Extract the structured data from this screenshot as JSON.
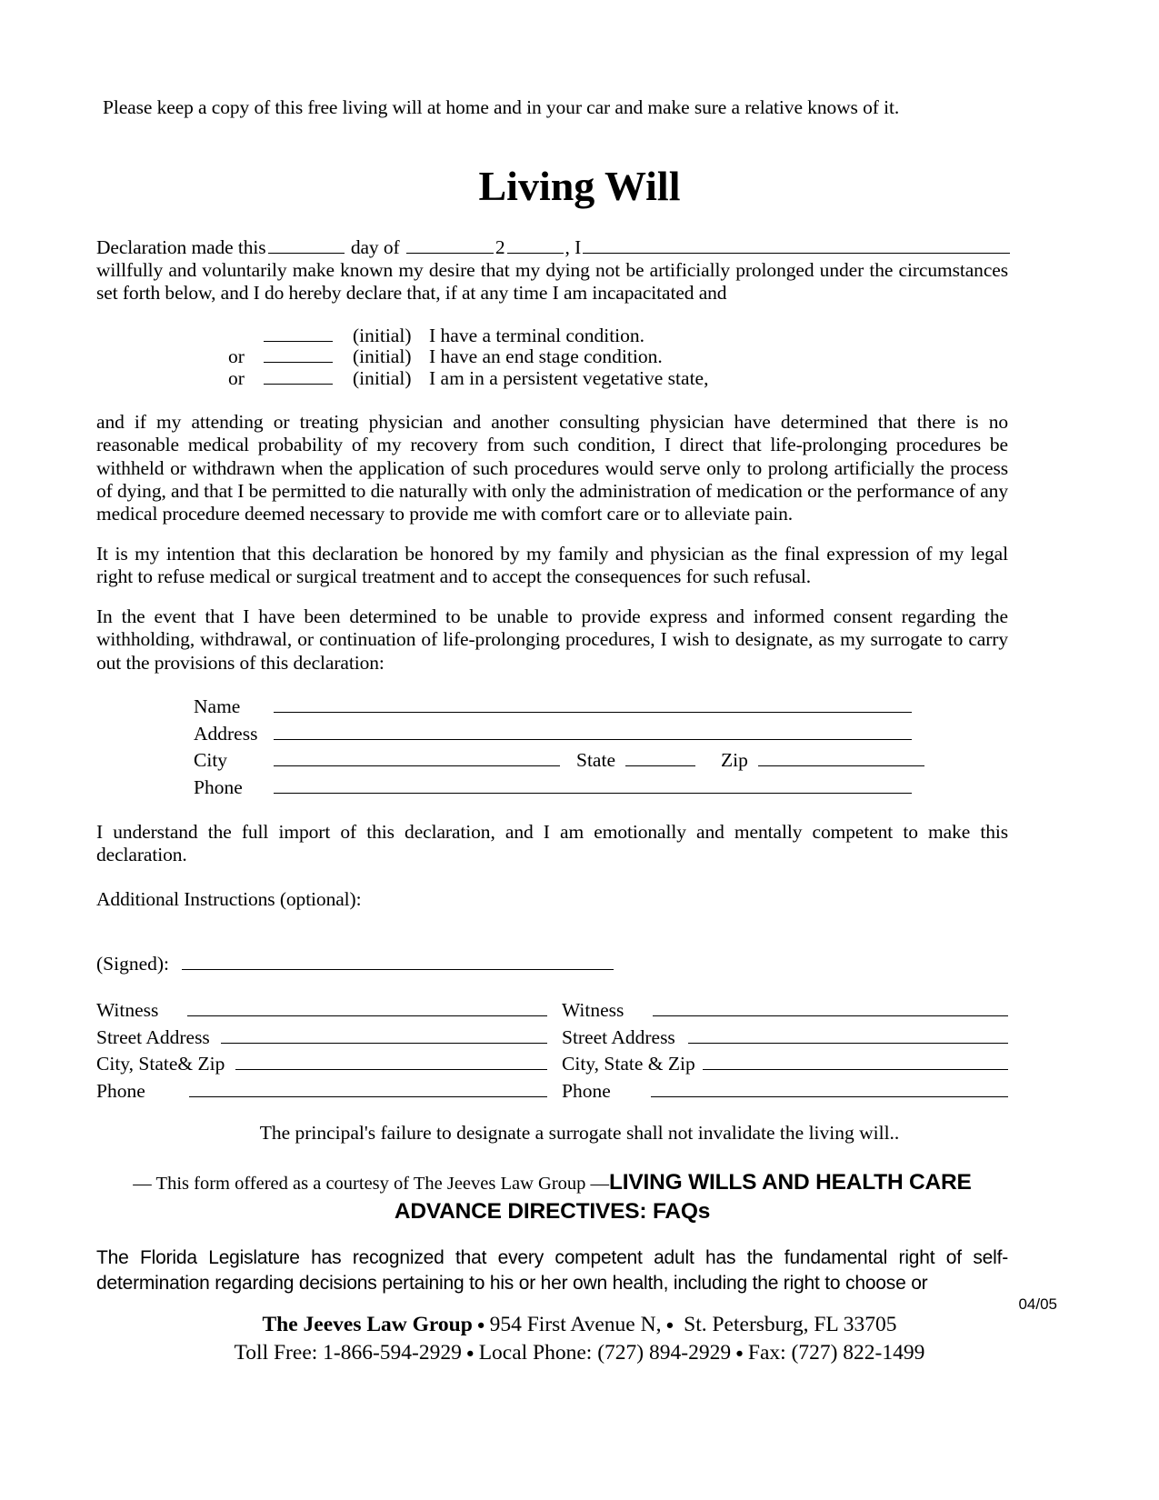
{
  "document": {
    "intro_note": "Please keep a copy of this free living will at home and in your car and make sure a relative knows of it.",
    "title": "Living Will"
  },
  "declaration": {
    "prefix": "Declaration made this",
    "day_word": "day of",
    "year_prefix": "2",
    "after_year": ", I",
    "paragraph": "willfully and voluntarily make known my desire that my dying not be artificially prolonged under the circumstances set forth below, and I do hereby declare that, if at any time I am incapacitated and"
  },
  "initial_options": [
    {
      "or": "",
      "tag": "(initial)",
      "text": "I have a terminal condition."
    },
    {
      "or": "or",
      "tag": "(initial)",
      "text": "I have an end stage condition."
    },
    {
      "or": "or",
      "tag": "(initial)",
      "text": "I am in a persistent vegetative state,"
    }
  ],
  "paragraphs": {
    "physician": "and if my attending or treating physician and another consulting physician have determined that there is no reasonable medical probability of my recovery from such condition, I direct that life-prolonging procedures be withheld or withdrawn when the application of such procedures would serve only to prolong artificially the process of dying, and that I be permitted to die naturally with only the administration of medication or the performance of any medical procedure deemed necessary to provide me with comfort care or to alleviate pain.",
    "intention": "It is my intention that this declaration be honored by my family and physician as the final expression of my legal right to refuse medical or surgical treatment and to accept the consequences for such refusal.",
    "surrogate_intro": "In the event that I have been determined to be unable to provide express and informed consent regarding the withholding, withdrawal, or continuation of life-prolonging procedures, I wish to designate, as my surrogate to carry out the provisions of this declaration:",
    "understanding": "I understand the full import of this declaration, and I am emotionally and mentally competent to make this declaration.",
    "additional_instructions": "Additional Instructions (optional):"
  },
  "surrogate_fields": {
    "name": "Name",
    "address": "Address",
    "city": "City",
    "state": "State",
    "zip": "Zip",
    "phone": "Phone"
  },
  "signature": {
    "signed_label": "(Signed):"
  },
  "witnesses": {
    "rows": [
      {
        "left_label": "Witness",
        "right_label": "Witness"
      },
      {
        "left_label": "Street Address",
        "right_label": "Street Address"
      },
      {
        "left_label": "City, State& Zip",
        "right_label": "City, State & Zip"
      },
      {
        "left_label": "Phone",
        "right_label": "Phone"
      }
    ]
  },
  "notes": {
    "principal": "The principal's failure to designate a surrogate shall not invalidate the living will..",
    "courtesy_prefix": "— This form offered as a courtesy of The Jeeves Law Group —",
    "faq_heading": "LIVING WILLS AND HEALTH CARE ADVANCE DIRECTIVES: FAQs",
    "florida_paragraph": "The Florida Legislature has recognized that every competent adult has the fundamental right of self-determination regarding decisions pertaining to his or her own health, including the right to choose or",
    "revision_date": "04/05"
  },
  "footer": {
    "firm_name": "The Jeeves Law Group",
    "street": "954 First Avenue N,",
    "city_state_zip": "St. Petersburg, FL 33705",
    "toll_free": "Toll Free: 1-866-594-2929",
    "local_phone": "Local Phone: (727) 894-2929",
    "fax": "Fax: (727) 822-1499"
  }
}
